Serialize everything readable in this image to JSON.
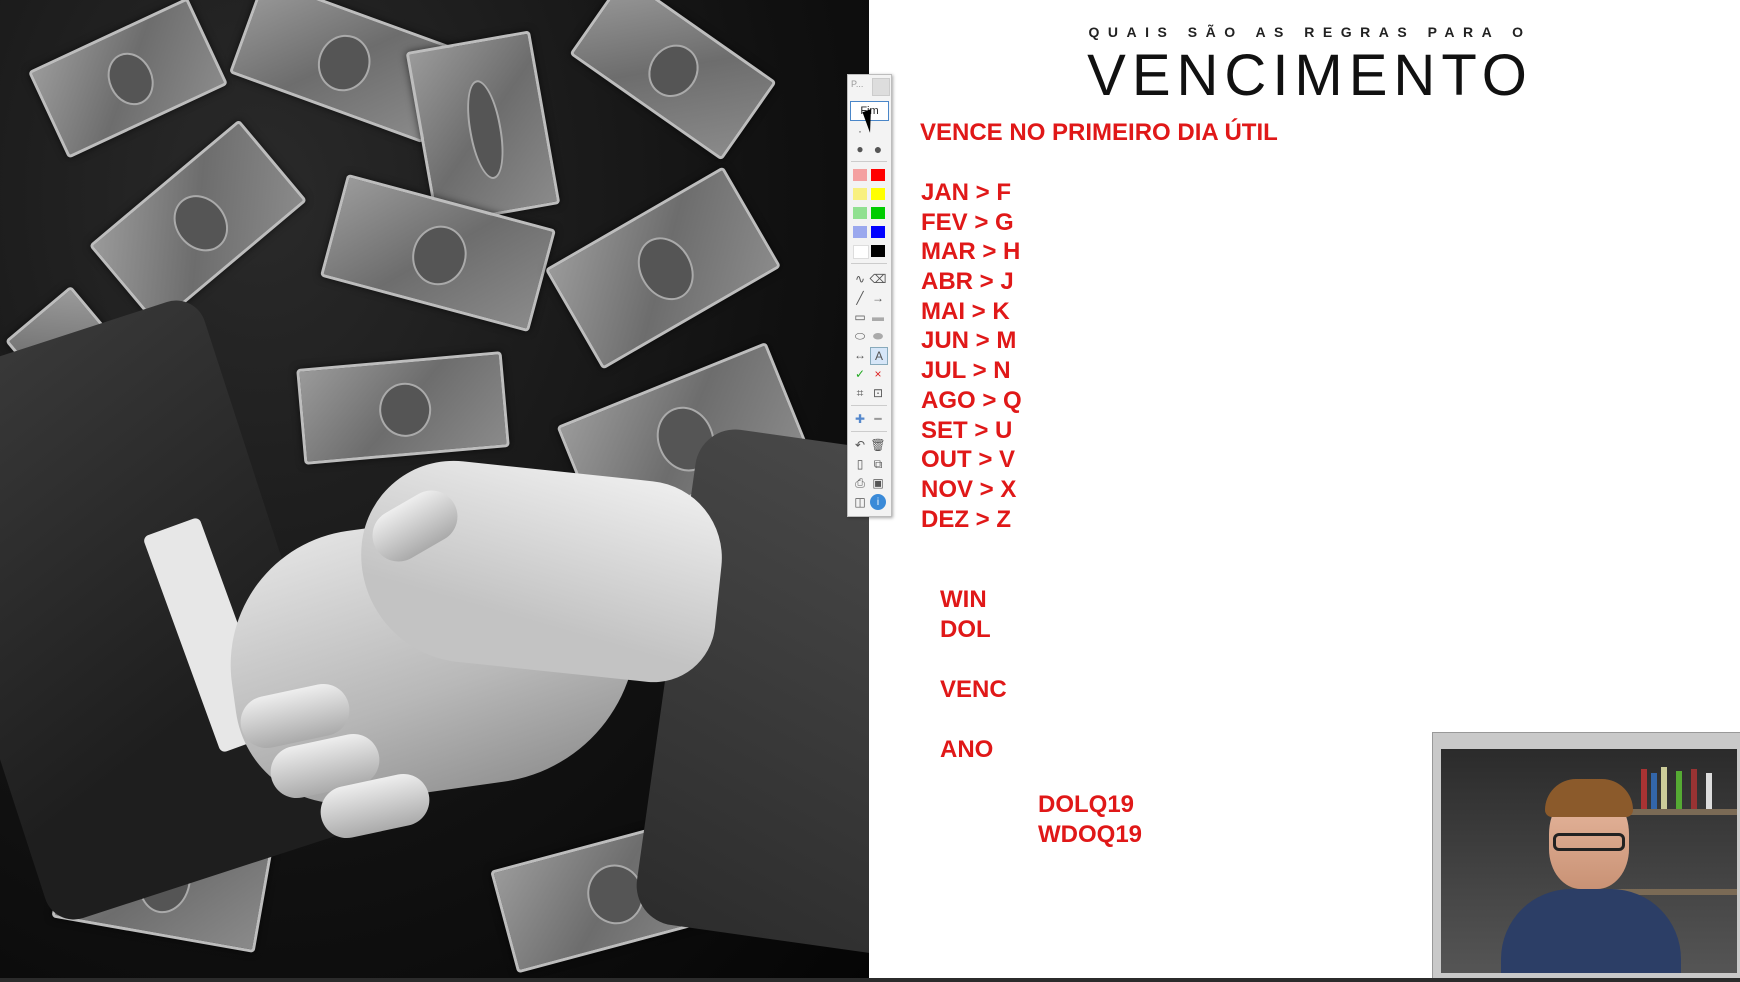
{
  "slide": {
    "subtitle": "QUAIS SÃO AS REGRAS PARA O",
    "title": "VENCIMENTO",
    "rule": "VENCE NO PRIMEIRO DIA ÚTIL",
    "months": [
      "JAN > F",
      "FEV > G",
      "MAR > H",
      "ABR > J",
      "MAI > K",
      "JUN > M",
      "JUL > N",
      "AGO > Q",
      "SET > U",
      "OUT > V",
      "NOV > X",
      "DEZ > Z"
    ],
    "tickers": [
      "WIN",
      "DOL",
      "",
      "VENC",
      "",
      "ANO"
    ],
    "examples": [
      "DOLQ19",
      "WDOQ19"
    ]
  },
  "toolbar": {
    "header_text": "P...",
    "end_button": "Fim",
    "colors": [
      "#f44336",
      "#ff0000",
      "#ffee44",
      "#ffff00",
      "#44dd44",
      "#00cc00",
      "#5566ee",
      "#0000ff",
      "#ffffff",
      "#000000"
    ],
    "text_tool": "A",
    "check": "✓",
    "close": "×"
  },
  "colors": {
    "accent_red": "#e01818"
  }
}
